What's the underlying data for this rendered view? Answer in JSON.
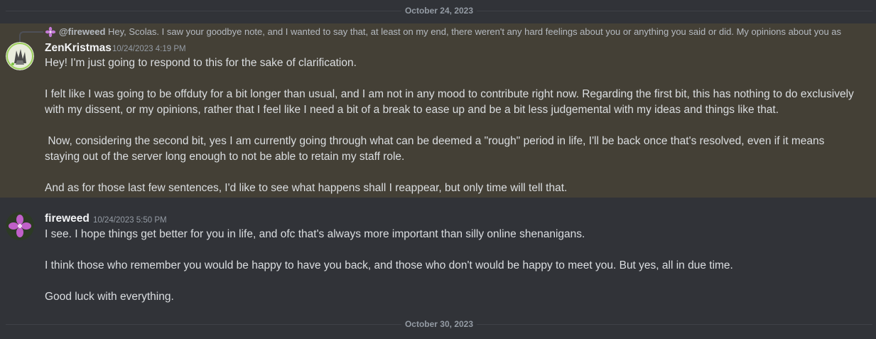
{
  "dividers": {
    "first": "October 24, 2023",
    "second": "October 30, 2023"
  },
  "messages": [
    {
      "reply": {
        "mention": "@fireweed",
        "text": "Hey, Scolas. I saw your goodbye note, and I wanted to say that, at least on my end, there weren't any hard feelings about you or anything you said or did. My opinions about you as"
      },
      "username": "ZenKristmas",
      "timestamp": "10/24/2023 4:19 PM",
      "paragraphs": [
        "Hey! I'm just going to respond to this for the sake of clarification.",
        "I felt like I was going to be offduty for a bit longer than usual, and I am not in any mood to contribute right now. Regarding the first bit, this has nothing to do exclusively with my dissent, or my opinions, rather that I feel like I need a bit of a break to ease up and be a bit less judgemental with my ideas and things like that.",
        " Now, considering the second bit, yes I am currently going through what can be deemed a \"rough\" period in life, I'll be back once that's resolved, even if it means staying out of the server long enough to not be able to retain my staff role.",
        "And as for those last few sentences, I'd like to see what happens shall I reappear, but only time will tell that."
      ]
    },
    {
      "username": "fireweed",
      "timestamp": "10/24/2023 5:50 PM",
      "paragraphs": [
        "I see. I hope things get better for you in life, and ofc that's always more important than silly online shenanigans.",
        "I think those who remember you would be happy to have you back, and those who don't would be happy to meet you. But yes, all in due time.",
        "Good luck with everything."
      ]
    }
  ],
  "colors": {
    "background": "#313338",
    "highlight": "#444036",
    "username": "#f2f3f5",
    "muted": "#949ba4"
  }
}
